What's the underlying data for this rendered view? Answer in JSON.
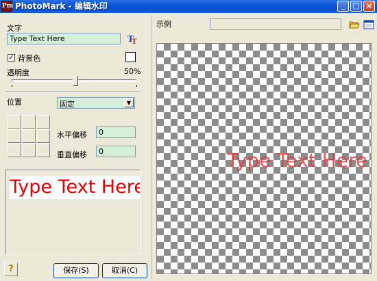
{
  "window": {
    "title": "PhotoMark - 编辑水印",
    "app_icon_label": "Pm"
  },
  "text_section": {
    "label": "文字",
    "value": "Type Text Here",
    "font_icon": "font-icon"
  },
  "background": {
    "checkbox_label": "背景色",
    "checked": true,
    "swatch_color": "#ffffff"
  },
  "opacity": {
    "label": "透明度",
    "value_text": "50%",
    "value": 0.5
  },
  "position": {
    "label": "位置",
    "mode_selected": "固定",
    "h_offset_label": "水平偏移",
    "h_offset_value": "0",
    "v_offset_label": "垂直偏移",
    "v_offset_value": "0",
    "anchor_selected": "center"
  },
  "preview": {
    "text": "Type Text Here",
    "color": "#e00000"
  },
  "buttons": {
    "save": "保存(S)",
    "cancel": "取消(C)",
    "help": "?"
  },
  "example": {
    "label": "示例",
    "path_value": "",
    "watermark_text": "Type Text Here"
  }
}
